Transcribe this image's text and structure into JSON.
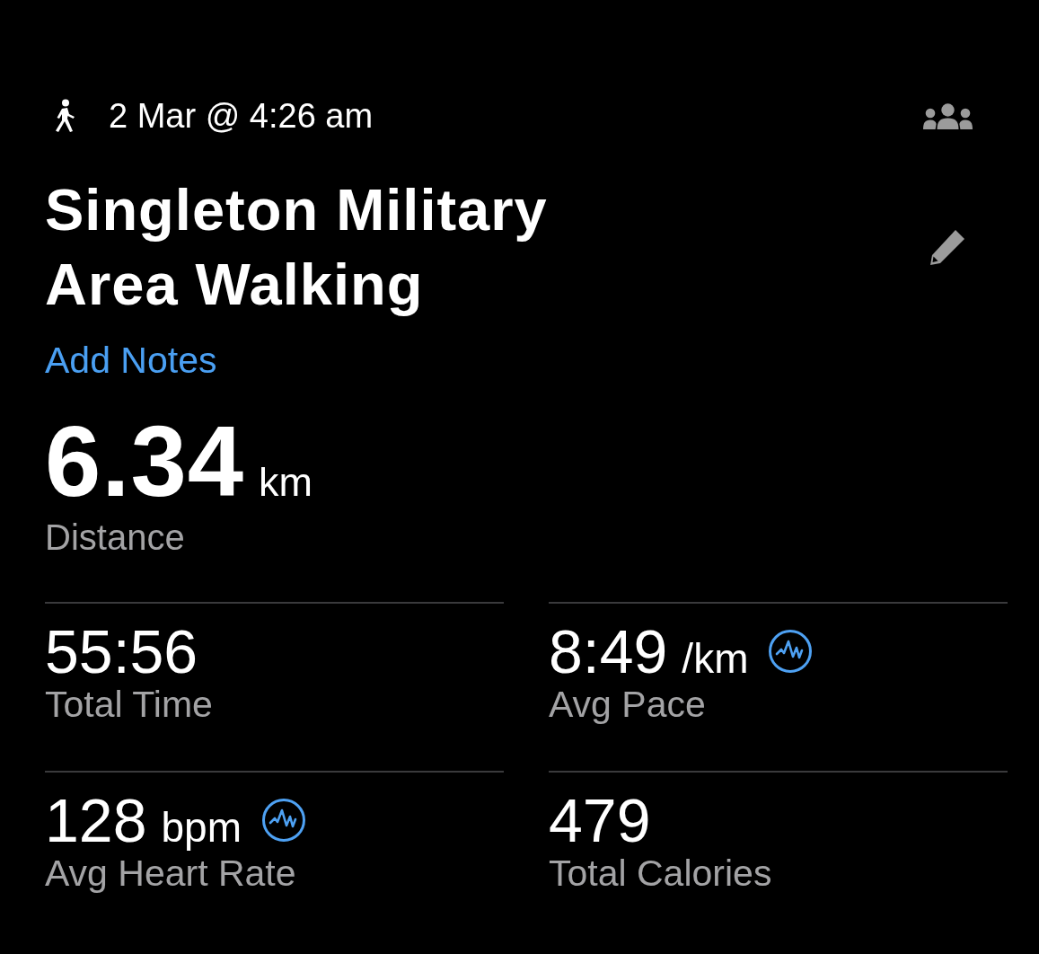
{
  "header": {
    "date": "2 Mar @ 4:26 am"
  },
  "title": "Singleton Military Area Walking",
  "add_notes_link": "Add Notes",
  "distance": {
    "value": "6.34",
    "unit": "km",
    "label": "Distance"
  },
  "stats": [
    {
      "value": "55:56",
      "label": "Total Time",
      "detail_icon": false
    },
    {
      "value": "8:49",
      "unit": "/km",
      "label": "Avg Pace",
      "detail_icon": true
    },
    {
      "value": "128",
      "unit": "bpm",
      "label": "Avg Heart Rate",
      "detail_icon": true
    },
    {
      "value": "479",
      "label": "Total Calories",
      "detail_icon": false
    }
  ]
}
